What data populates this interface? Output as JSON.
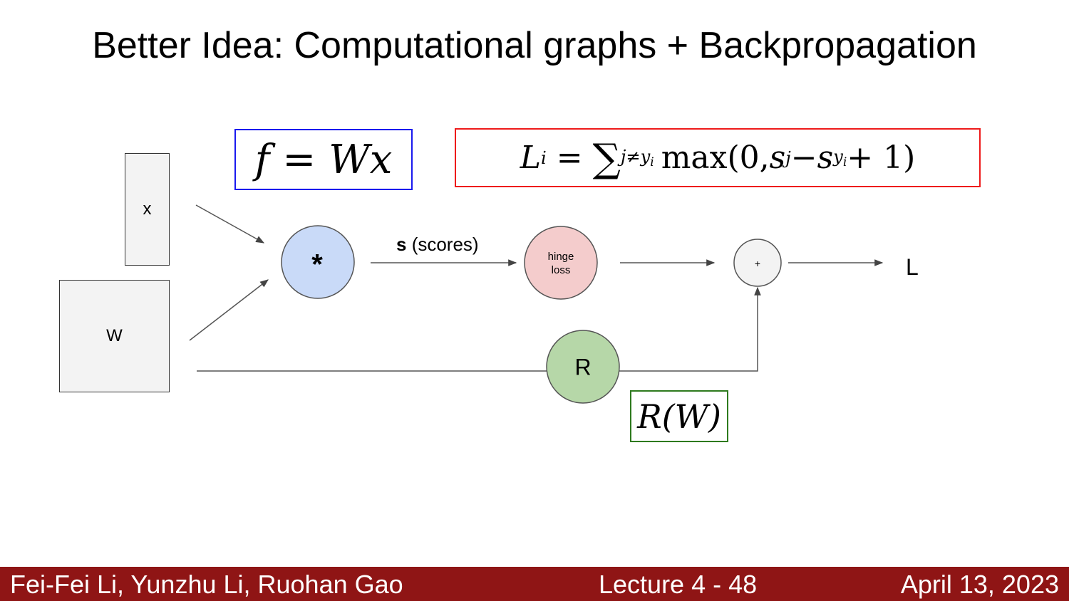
{
  "title": "Better Idea: Computational graphs + Backpropagation",
  "formulas": {
    "score": {
      "f": "f",
      "eq": "=",
      "rhs": "Wx"
    },
    "loss": {
      "L": "L",
      "i": "i",
      "eq": "=",
      "sum": "∑",
      "sum_sub": "j≠y",
      "sum_sub_i": "i",
      "max": "max(0, ",
      "sj": "s",
      "j": "j",
      "minus": " − ",
      "syi": "s",
      "yi": "y",
      "yi_i": "i",
      "tail": " + 1)"
    },
    "reg": "R(W)"
  },
  "diagram": {
    "input_x": "x",
    "input_w": "W",
    "node_multiply": "*",
    "edge_scores_bold": "s",
    "edge_scores_rest": " (scores)",
    "node_hinge": "hinge\nloss",
    "node_add": "+",
    "node_reg": "R",
    "output": "L"
  },
  "colors": {
    "multiply_node": "#c9daf8",
    "hinge_node": "#f4cccc",
    "add_node": "#f3f3f3",
    "reg_node": "#b6d7a8",
    "score_box_border": "#1a1aee",
    "loss_box_border": "#ee1a1a",
    "reg_box_border": "#2e7a1e",
    "footer_bg": "#8f1515"
  },
  "footer": {
    "authors": "Fei-Fei Li, Yunzhu Li, Ruohan Gao",
    "lecture": "Lecture 4 - 48",
    "date": "April 13, 2023"
  }
}
